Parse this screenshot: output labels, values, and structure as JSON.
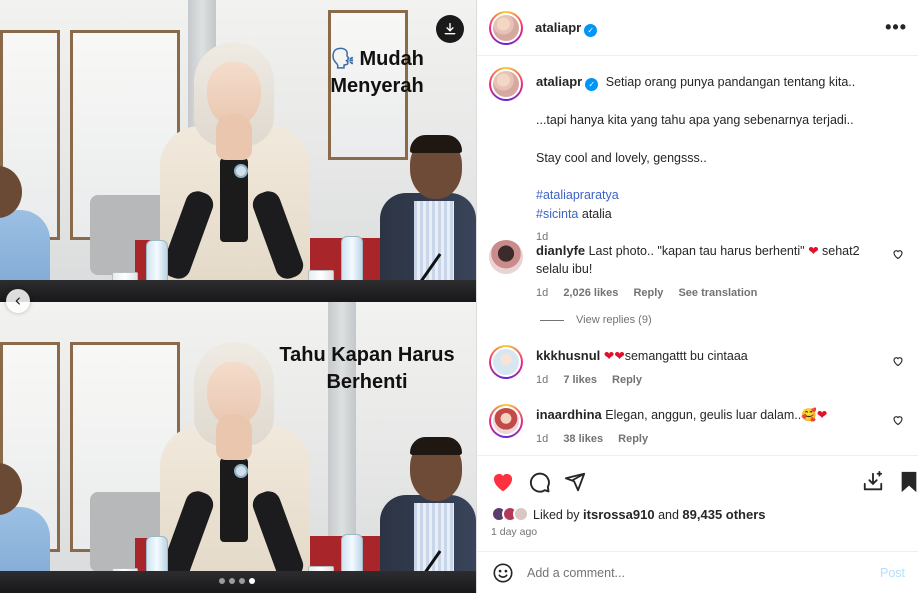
{
  "post": {
    "author": "ataliapr",
    "verified": true,
    "more_label": "•••"
  },
  "media": {
    "captions": [
      {
        "emoji": "🗣",
        "text": "Mudah Menyerah"
      },
      {
        "text": "Tahu Kapan Harus Berhenti"
      }
    ],
    "download_icon": "download-icon",
    "prev_icon": "chevron-left-icon",
    "dots_total": 4,
    "dots_active": 4
  },
  "caption": {
    "line1": "Setiap orang punya pandangan tentang kita..",
    "line2": "...tapi hanya kita yang tahu apa yang sebenarnya terjadi..",
    "line3": "Stay cool and lovely, gengsss..",
    "hashtag1": "#ataliapraratya",
    "hashtag2": "#sicinta",
    "hashtag2_suffix": " atalia",
    "time": "1d"
  },
  "comments": [
    {
      "user": "dianlyfe",
      "text_before": "Last photo.. \"kapan tau harus berhenti\" ",
      "heart": "❤",
      "text_after": " sehat2 selalu ibu!",
      "time": "1d",
      "likes": "2,026 likes",
      "reply": "Reply",
      "translate": "See translation",
      "view_replies": "View replies (9)"
    },
    {
      "user": "kkkhusnul",
      "hearts": "❤❤",
      "text": "semangattt bu cintaaa",
      "time": "1d",
      "likes": "7 likes",
      "reply": "Reply"
    },
    {
      "user": "inaardhina",
      "text": "Elegan, anggun, geulis luar dalam..",
      "emoji": "🥰",
      "heart": "❤",
      "time": "1d",
      "likes": "38 likes",
      "reply": "Reply"
    }
  ],
  "actions": {
    "like_icon": "heart-filled-icon",
    "comment_icon": "comment-icon",
    "share_icon": "share-icon",
    "save_icon": "bookmark-icon",
    "add_to_collection_icon": "add-to-collection-icon"
  },
  "likes": {
    "prefix": "Liked by ",
    "user": "itsrossa910",
    "middle": " and ",
    "count": "89,435 others",
    "time_ago": "1 day ago"
  },
  "add_comment": {
    "placeholder": "Add a comment...",
    "post_label": "Post"
  },
  "colors": {
    "accent": "#0095f6",
    "like_red": "#ff3040",
    "link_blue": "#3d63c7",
    "post_disabled": "#b2dffc"
  }
}
